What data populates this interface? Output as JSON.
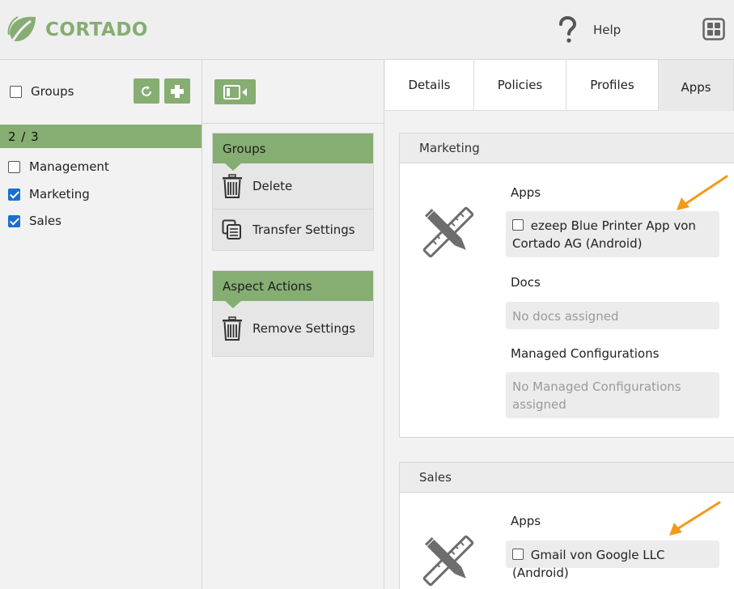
{
  "header": {
    "brand": "CORTADO",
    "help_label": "Help",
    "icons": [
      "leaf-logo-icon",
      "question-mark-icon",
      "app-grid-icon"
    ],
    "brand_color": "#86ad72"
  },
  "groups_panel": {
    "header_label": "Groups",
    "count": "2 / 3",
    "buttons": [
      "refresh-icon",
      "plus-icon"
    ],
    "items": [
      {
        "label": "Management",
        "checked": false
      },
      {
        "label": "Marketing",
        "checked": true
      },
      {
        "label": "Sales",
        "checked": true
      }
    ]
  },
  "actions_panel": {
    "groups_title": "Groups",
    "groups_actions": [
      {
        "label": "Delete",
        "icon": "trash-icon"
      },
      {
        "label": "Transfer Settings",
        "icon": "copy-icon"
      }
    ],
    "aspect_title": "Aspect Actions",
    "aspect_actions": [
      {
        "label": "Remove Settings",
        "icon": "trash-icon"
      }
    ]
  },
  "detail_panel": {
    "tabs": [
      {
        "label": "Details",
        "active": false
      },
      {
        "label": "Policies",
        "active": false
      },
      {
        "label": "Profiles",
        "active": false
      },
      {
        "label": "Apps",
        "active": true
      }
    ],
    "sections": [
      {
        "title": "Marketing",
        "apps_label": "Apps",
        "app": "ezeep Blue Printer App von Cortado AG (Android)",
        "docs_label": "Docs",
        "docs_value": "No docs assigned",
        "configs_label": "Managed Configurations",
        "configs_value": "No Managed Configurations assigned"
      },
      {
        "title": "Sales",
        "apps_label": "Apps",
        "app": "Gmail von Google LLC (Android)"
      }
    ]
  },
  "colors": {
    "accent_green": "#86ad72",
    "arrow_orange": "#f29a1a",
    "checkbox_blue": "#1a6fd1"
  }
}
